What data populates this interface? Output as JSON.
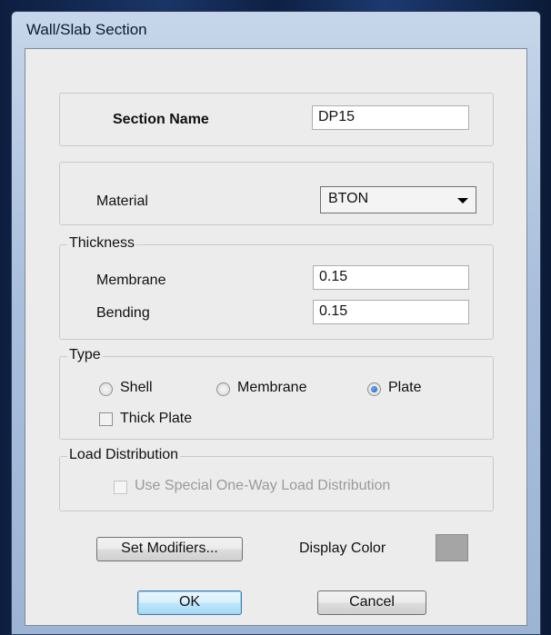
{
  "window": {
    "title": "Wall/Slab Section"
  },
  "section": {
    "label": "Section Name",
    "value": "DP15"
  },
  "material": {
    "label": "Material",
    "selected": "BTON"
  },
  "thickness": {
    "group_label": "Thickness",
    "membrane_label": "Membrane",
    "membrane_value": "0.15",
    "bending_label": "Bending",
    "bending_value": "0.15"
  },
  "type": {
    "group_label": "Type",
    "options": [
      "Shell",
      "Membrane",
      "Plate"
    ],
    "selected": "Plate",
    "thick_plate_label": "Thick Plate",
    "thick_plate_checked": false
  },
  "load_distribution": {
    "group_label": "Load Distribution",
    "option_label": "Use Special One-Way Load Distribution",
    "checked": false,
    "enabled": false
  },
  "buttons": {
    "set_modifiers": "Set Modifiers...",
    "display_color_label": "Display Color",
    "ok": "OK",
    "cancel": "Cancel"
  },
  "colors": {
    "display_color": "#a5a5a5",
    "desktop_background": "#0f2246"
  }
}
